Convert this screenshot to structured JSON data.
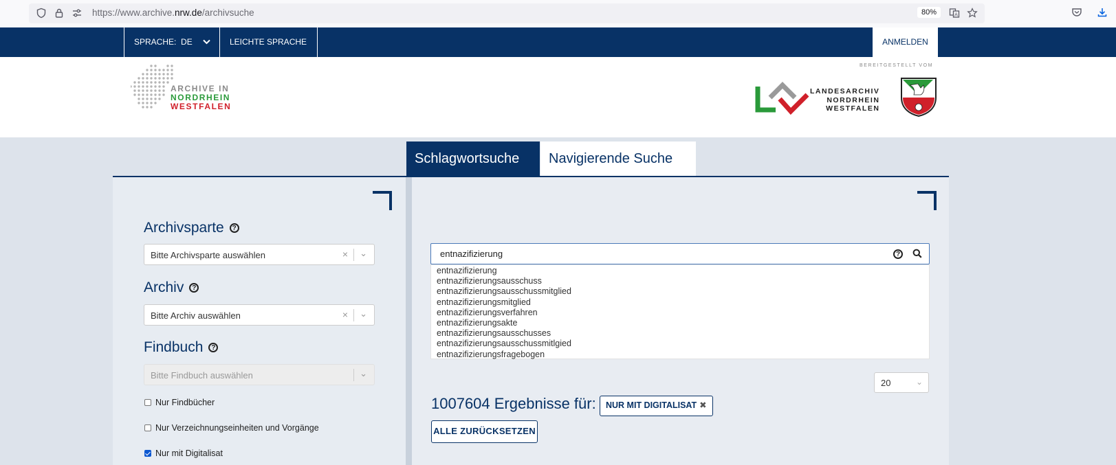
{
  "browser": {
    "url_prefix": "https://www.archive.",
    "url_domain": "nrw.de",
    "url_path": "/archivsuche",
    "zoom": "80%"
  },
  "topnav": {
    "language_label": "SPRACHE:",
    "language_value": "DE",
    "easy_language": "LEICHTE SPRACHE",
    "login": "ANMELDEN"
  },
  "header": {
    "logo_line1": "ARCHIVE IN",
    "logo_line2": "NORDRHEIN",
    "logo_line3": "WESTFALEN",
    "provided_by": "BEREITGESTELLT VOM",
    "la_line1": "LANDESARCHIV",
    "la_line2": "NORDRHEIN",
    "la_line3": "WESTFALEN"
  },
  "tabs": [
    {
      "label": "Schlagwortsuche",
      "active": true
    },
    {
      "label": "Navigierende Suche",
      "active": false
    }
  ],
  "filters": {
    "archivsparte_label": "Archivsparte",
    "archivsparte_placeholder": "Bitte Archivsparte auswählen",
    "archiv_label": "Archiv",
    "archiv_placeholder": "Bitte Archiv auswählen",
    "findbuch_label": "Findbuch",
    "findbuch_placeholder": "Bitte Findbuch auswählen",
    "checkboxes": [
      {
        "label": "Nur Findbücher",
        "checked": false
      },
      {
        "label": "Nur Verzeichnungseinheiten und Vorgänge",
        "checked": false
      },
      {
        "label": "Nur mit Digitalisat",
        "checked": true
      }
    ]
  },
  "search": {
    "value": "entnazifizierung",
    "suggestions": [
      "entnazifizierung",
      "entnazifizierungsausschuss",
      "entnazifizierungsausschussmitglied",
      "entnazifizierungsmitglied",
      "entnazifizierungsverfahren",
      "entnazifizierungsakte",
      "entnazifizierungsausschusses",
      "entnazifizierungsausschussmitlgied",
      "entnazifizierungsfragebogen"
    ]
  },
  "results": {
    "page_size": "20",
    "count_text": "1007604 Ergebnisse für:",
    "active_filter": "NUR MIT DIGITALISAT",
    "reset_label": "ALLE ZURÜCKSETZEN"
  },
  "colors": {
    "primary": "#083266",
    "green": "#2a9a3a",
    "red": "#d0202a"
  }
}
